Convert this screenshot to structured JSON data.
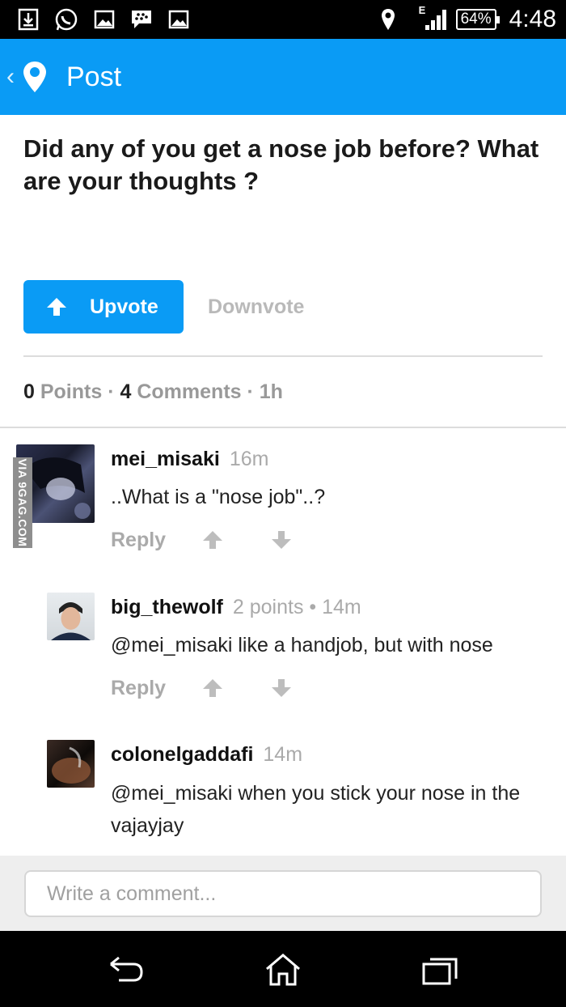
{
  "status_bar": {
    "left_icons": [
      "download-icon",
      "whatsapp-icon",
      "image-icon",
      "bbm-icon",
      "image-icon"
    ],
    "network": "E",
    "battery": "64%",
    "time": "4:48"
  },
  "app_bar": {
    "title": "Post"
  },
  "post": {
    "title": "Did any of you get a nose job before? What are your thoughts ?",
    "upvote_label": "Upvote",
    "downvote_label": "Downvote",
    "points_count": "0",
    "points_label": "Points",
    "comments_count": "4",
    "comments_label": "Comments",
    "age": "1h"
  },
  "comments": [
    {
      "user": "mei_misaki",
      "meta": "16m",
      "text": "..What is a \"nose job\"..?",
      "reply_label": "Reply"
    },
    {
      "user": "big_thewolf",
      "meta": "2 points • 14m",
      "text": "@mei_misaki like a handjob, but with nose",
      "reply_label": "Reply"
    },
    {
      "user": "colonelgaddafi",
      "meta": "14m",
      "text": "@mei_misaki when you stick your nose in the vajayjay"
    }
  ],
  "watermark": "VIA 9GAG.COM",
  "comment_box": {
    "placeholder": "Write a comment..."
  },
  "colors": {
    "accent": "#0a9bf5",
    "muted": "#aaaaaa"
  }
}
